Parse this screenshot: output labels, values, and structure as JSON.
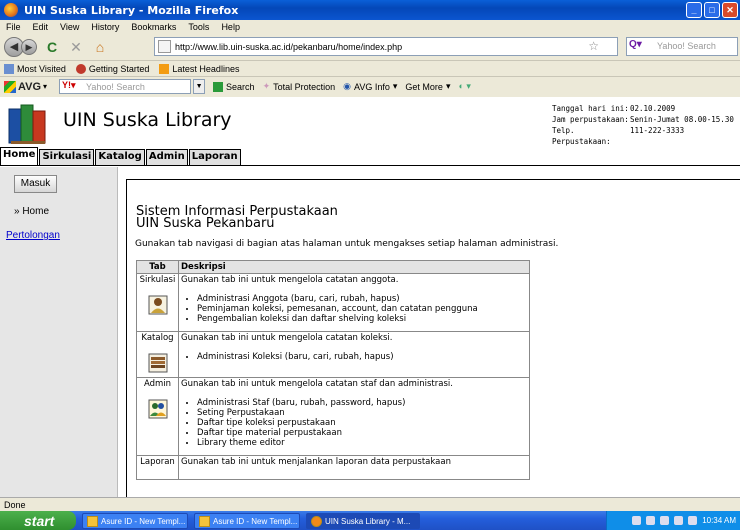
{
  "window": {
    "title": "UIN Suska Library - Mozilla Firefox"
  },
  "menu": [
    "File",
    "Edit",
    "View",
    "History",
    "Bookmarks",
    "Tools",
    "Help"
  ],
  "nav": {
    "url": "http://www.lib.uin-suska.ac.id/pekanbaru/home/index.php",
    "search_placeholder": "Yahoo! Search"
  },
  "bookmarks": [
    "Most Visited",
    "Getting Started",
    "Latest Headlines"
  ],
  "avg": {
    "logo": "AVG",
    "search_placeholder": "Yahoo! Search",
    "search_btn": "Search",
    "total_protection": "Total Protection",
    "avg_info": "AVG Info",
    "get_more": "Get More"
  },
  "site": {
    "title": "UIN Suska Library",
    "info": [
      {
        "label": "Tanggal hari ini:",
        "value": "02.10.2009"
      },
      {
        "label": "Jam perpustakaan:",
        "value": "Senin-Jumat 08.00-15.30"
      },
      {
        "label": "Telp. Perpustakaan:",
        "value": "111-222-3333"
      }
    ]
  },
  "tabs": [
    "Home",
    "Sirkulasi",
    "Katalog",
    "Admin",
    "Laporan"
  ],
  "sidebar": {
    "login": "Masuk",
    "home": "» Home",
    "help": "Pertolongan"
  },
  "main": {
    "title_line1": "Sistem Informasi Perpustakaan",
    "title_line2": "UIN Suska Pekanbaru",
    "intro": "Gunakan tab navigasi di bagian atas halaman untuk mengakses setiap halaman administrasi.",
    "table_headers": [
      "Tab",
      "Deskripsi"
    ],
    "rows": [
      {
        "tab": "Sirkulasi",
        "desc": "Gunakan tab ini untuk mengelola catatan anggota.",
        "items": [
          "Administrasi Anggota (baru, cari, rubah, hapus)",
          "Peminjaman koleksi, pemesanan, account, dan catatan pengguna",
          "Pengembalian koleksi dan daftar shelving koleksi"
        ]
      },
      {
        "tab": "Katalog",
        "desc": "Gunakan tab ini untuk mengelola catatan koleksi.",
        "items": [
          "Administrasi Koleksi (baru, cari, rubah, hapus)"
        ]
      },
      {
        "tab": "Admin",
        "desc": "Gunakan tab ini untuk mengelola catatan staf dan administrasi.",
        "items": [
          "Administrasi Staf (baru, rubah, password, hapus)",
          "Seting Perpustakaan",
          "Daftar tipe koleksi perpustakaan",
          "Daftar tipe material perpustakaan",
          "Library theme editor"
        ]
      },
      {
        "tab": "Laporan",
        "desc": "Gunakan tab ini untuk menjalankan laporan data perpustakaan",
        "items": []
      }
    ]
  },
  "status": "Done",
  "taskbar": {
    "start": "start",
    "tasks": [
      "Asure ID - New Templ...",
      "Asure ID - New Templ...",
      "UIN Suska Library - M..."
    ],
    "clock": "10:34 AM"
  }
}
